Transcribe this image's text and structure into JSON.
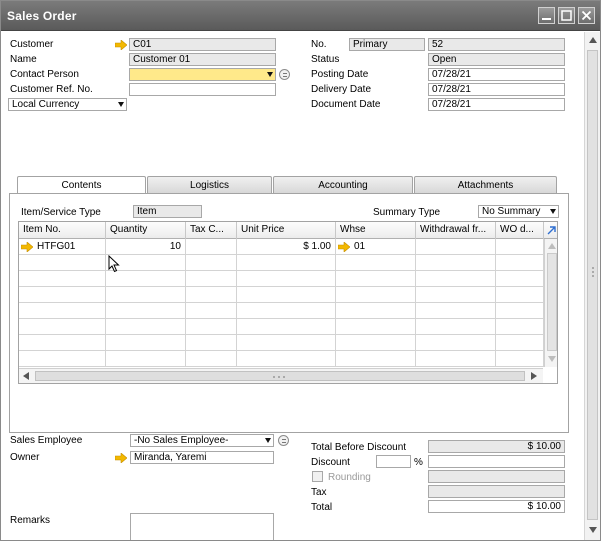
{
  "window": {
    "title": "Sales Order"
  },
  "header_left": {
    "customer_label": "Customer",
    "customer_value": "C01",
    "name_label": "Name",
    "name_value": "Customer 01",
    "contact_label": "Contact Person",
    "contact_value": "",
    "ref_label": "Customer Ref. No.",
    "ref_value": "",
    "currency_value": "Local Currency"
  },
  "header_right": {
    "no_label": "No.",
    "no_series": "Primary",
    "no_value": "52",
    "status_label": "Status",
    "status_value": "Open",
    "posting_label": "Posting Date",
    "posting_value": "07/28/21",
    "delivery_label": "Delivery Date",
    "delivery_value": "07/28/21",
    "document_label": "Document Date",
    "document_value": "07/28/21"
  },
  "tabs": [
    {
      "label": "Contents",
      "active": true
    },
    {
      "label": "Logistics",
      "active": false
    },
    {
      "label": "Accounting",
      "active": false
    },
    {
      "label": "Attachments",
      "active": false
    }
  ],
  "contents": {
    "item_type_label": "Item/Service Type",
    "item_type_value": "Item",
    "summary_label": "Summary Type",
    "summary_value": "No Summary",
    "columns": [
      "Item No.",
      "Quantity",
      "Tax C...",
      "Unit Price",
      "Whse",
      "Withdrawal fr...",
      "WO d..."
    ],
    "rows": [
      {
        "item_no": "HTFG01",
        "quantity": "10",
        "tax": "",
        "unit_price": "$ 1.00",
        "whse": "01",
        "withdrawal": "",
        "wo": ""
      }
    ]
  },
  "footer_left": {
    "sales_emp_label": "Sales Employee",
    "sales_emp_value": "-No Sales Employee-",
    "owner_label": "Owner",
    "owner_value": "Miranda, Yaremi",
    "remarks_label": "Remarks",
    "remarks_value": ""
  },
  "footer_right": {
    "tbd_label": "Total Before Discount",
    "tbd_value": "$ 10.00",
    "discount_label": "Discount",
    "discount_pct": "",
    "pct_sign": "%",
    "discount_value": "",
    "rounding_label": "Rounding",
    "tax_label": "Tax",
    "tax_value": "",
    "total_label": "Total",
    "total_value": "$ 10.00"
  },
  "colors": {
    "link_arrow": "#f3b800",
    "mandatory_yellow": "#ffe98a",
    "titlebar": "#6b6b6b"
  }
}
